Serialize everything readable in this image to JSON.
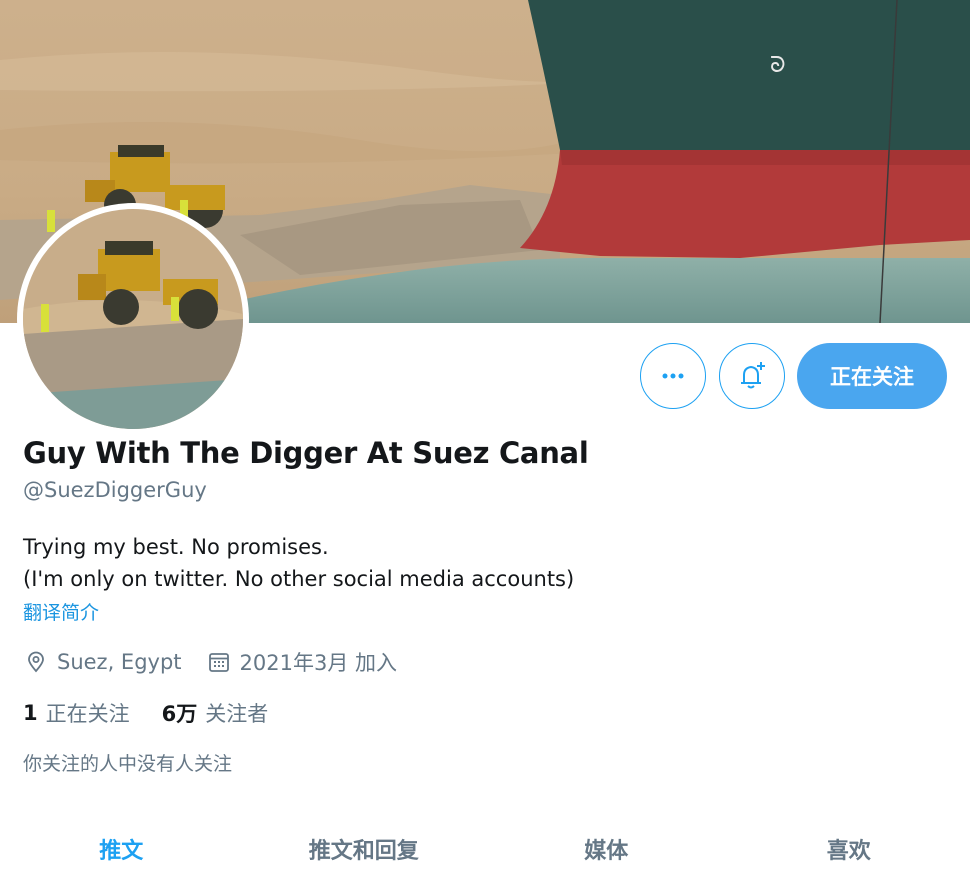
{
  "profile": {
    "display_name": "Guy With The Digger At Suez Canal",
    "handle": "@SuezDiggerGuy",
    "bio_line1": "Trying my best. No promises.",
    "bio_line2": "(I'm only on twitter. No other social media accounts)",
    "translate_label": "翻译简介",
    "location": "Suez, Egypt",
    "joined": "2021年3月 加入",
    "following_count": "1",
    "following_label": "正在关注",
    "followers_count": "6万",
    "followers_label": "关注者",
    "followers_you_know": "你关注的人中没有人关注"
  },
  "actions": {
    "more_icon": "more-horizontal-icon",
    "notify_icon": "bell-plus-icon",
    "follow_label": "正在关注"
  },
  "tabs": [
    {
      "label": "推文",
      "active": true
    },
    {
      "label": "推文和回复",
      "active": false
    },
    {
      "label": "媒体",
      "active": false
    },
    {
      "label": "喜欢",
      "active": false
    }
  ],
  "colors": {
    "accent": "#1da1f2",
    "follow_button": "#4aa6ef",
    "secondary_text": "#657786",
    "primary_text": "#14171a"
  }
}
